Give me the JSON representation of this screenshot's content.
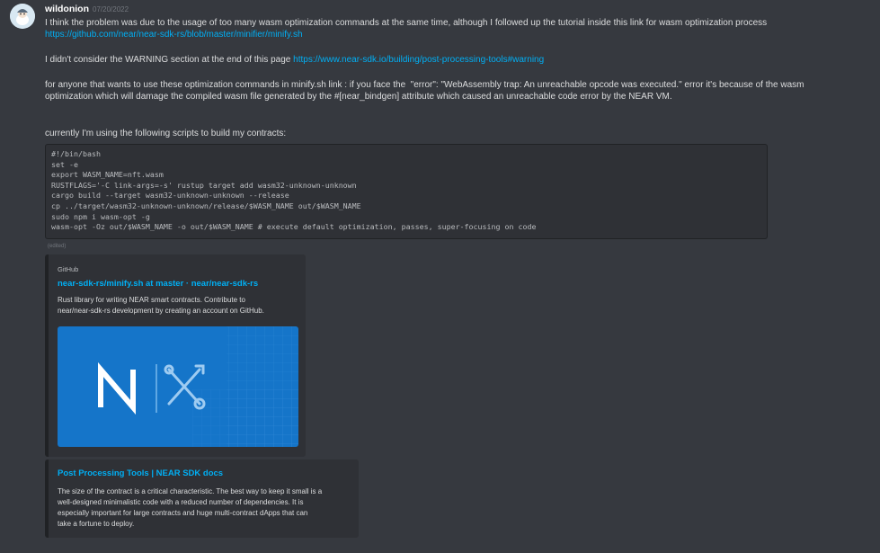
{
  "message": {
    "username": "wildonion",
    "timestamp": "07/20/2022",
    "line1": "I think the problem was due to the usage of too many wasm optimization commands at the same time, although I followed up the tutorial inside this link for wasm optimization process",
    "link1": "https://github.com/near/near-sdk-rs/blob/master/minifier/minify.sh",
    "line2_prefix": "I didn't consider the WARNING section at the end of this page ",
    "link2": "https://www.near-sdk.io/building/post-processing-tools#warning",
    "line3a": "for anyone that wants to use these optimization commands in minify.sh link : if you face the  \"error\": \"WebAssembly trap: An unreachable opcode was executed.\" error it's because of the wasm",
    "line3b": "optimization which will damage the compiled wasm file generated by the #[near_bindgen] attribute which caused an unreachable code error by the NEAR VM.",
    "line4": "currently I'm using the following scripts to build my contracts:",
    "code_lines": [
      "#!/bin/bash",
      "set -e",
      "export WASM_NAME=nft.wasm",
      "RUSTFLAGS='-C link-args=-s' rustup target add wasm32-unknown-unknown",
      "cargo build --target wasm32-unknown-unknown --release",
      "cp ../target/wasm32-unknown-unknown/release/$WASM_NAME out/$WASM_NAME",
      "sudo npm i wasm-opt -g",
      "wasm-opt -Oz out/$WASM_NAME -o out/$WASM_NAME # execute default optimization, passes, super-focusing on code"
    ],
    "edited": "(edited)"
  },
  "embed1": {
    "provider": "GitHub",
    "title": "near-sdk-rs/minify.sh at master · near/near-sdk-rs",
    "desc1": "Rust library for writing NEAR smart contracts. Contribute to",
    "desc2": "near/near-sdk-rs development by creating an account on GitHub.",
    "image_bg": "#1575c9"
  },
  "embed2": {
    "title": "Post Processing Tools | NEAR SDK docs",
    "desc1": "The size of the contract is a critical characteristic. The best way to keep it small is a",
    "desc2": "well-designed minimalistic code with a reduced number of dependencies. It is",
    "desc3": "especially important for large contracts and huge multi-contract dApps that can",
    "desc4": "take a fortune to deploy."
  },
  "colors": {
    "background": "#36393f",
    "link": "#00aff4",
    "embed_bg": "#2f3136",
    "code_bg": "#2f3136"
  }
}
